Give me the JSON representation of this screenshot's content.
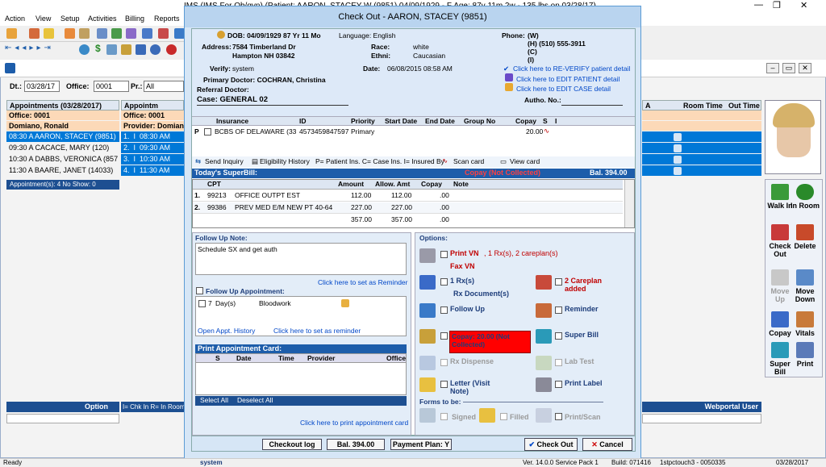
{
  "window": {
    "title": "IMS (IMS For Ob/gyn)      (Patient: AARON, STACEY W (9851) 04/09/1929 - F  Age: 87y 11m 2w - 135 lbs on 03/28/17)"
  },
  "menu": [
    "Action",
    "View",
    "Setup",
    "Activities",
    "Billing",
    "Reports"
  ],
  "filters": {
    "dt_label": "Dt.:",
    "dt_value": "03/28/17",
    "office_label": "Office:",
    "office_value": "0001",
    "pr_label": "Pr.:",
    "pr_value": "All"
  },
  "appointments": {
    "header": "Appointments (03/28/2017)",
    "office": "Office: 0001",
    "provider": "Domiano, Ronald",
    "rows": [
      "08:30 A   AARON, STACEY (9851)",
      "09:30 A   CACACE, MARY  (120)",
      "10:30 A   DABBS, VERONICA  (857",
      "11:30 A   BAARE, JANET  (14033)"
    ],
    "summary": "Appointment(s): 4   No Show: 0",
    "option": "Option",
    "legend": "I= Chk In  R= In Room"
  },
  "appt_grid2": {
    "header": "Appointm",
    "office": "Office: 0001",
    "provider": "Provider: Domian",
    "rows": [
      {
        "n": "1.",
        "t": "08:30 AM"
      },
      {
        "n": "2.",
        "t": "09:30 AM"
      },
      {
        "n": "3.",
        "t": "10:30 AM"
      },
      {
        "n": "4.",
        "t": "11:30 AM"
      }
    ]
  },
  "right_grid": {
    "cols": [
      "A",
      "Room Time",
      "Out Time"
    ]
  },
  "webportal": "Webportal User",
  "right_panel": {
    "buttons": [
      "Walk In",
      "In Room",
      "Check Out",
      "Delete",
      "Move Up",
      "Move Down",
      "Copay",
      "Vitals",
      "Super Bill",
      "Print"
    ]
  },
  "dialog": {
    "title": "Check Out - AARON, STACEY  (9851)",
    "dob": "DOB: 04/09/1929  87 Yr 11 Mo",
    "language": "Language: English",
    "phone_label": "Phone:",
    "phone_w": "(W)",
    "phone_h": "(H)  (510) 555-3911",
    "phone_c": "(C)",
    "phone_i": "(I)",
    "address_label": "Address:",
    "address1": "7584 Timberland Dr",
    "address2": "Hampton  NH  03842",
    "race_label": "Race:",
    "race": "white",
    "ethni_label": "Ethni:",
    "ethni": "Caucasian",
    "verify_label": "Verify:",
    "verify": "system",
    "date_label": "Date:",
    "date": "06/08/2015 08:58 AM",
    "reverify_link": "Click here to RE-VERIFY patient detail",
    "edit_patient_link": "Click here to EDIT PATIENT detail",
    "edit_case_link": "Click here to EDIT CASE detail",
    "primary_doctor": "Primary Doctor: COCHRAN, Christina",
    "referral_doctor": "Referral Doctor:",
    "case": "Case: GENERAL 02",
    "autho": "Autho. No.:",
    "ins_cols": [
      "Insurance",
      "ID",
      "Priority",
      "Start Date",
      "End Date",
      "Group No",
      "Copay",
      "S",
      "I"
    ],
    "ins_row": {
      "p": "P",
      "name": "BCBS OF DELAWARE  (33",
      "id": "4573459847597",
      "priority": "Primary",
      "copay": "20.00"
    },
    "ins_links": [
      "Send Inquiry",
      "Eligibility History",
      "P= Patient Ins. C= Case Ins.  I= Insured By",
      "Scan card",
      "View card"
    ],
    "superbill_title": "Today's SuperBill:",
    "superbill_copay": "Copay (Not Collected)",
    "superbill_bal": "Bal.  394.00",
    "sb_cols": [
      "CPT",
      "Amount",
      "Allow. Amt",
      "Copay",
      "Note"
    ],
    "sb_rows": [
      {
        "n": "1.",
        "cpt": "99213",
        "desc": "OFFICE OUTPT EST",
        "amt": "112.00",
        "allow": "112.00",
        "copay": ".00"
      },
      {
        "n": "2.",
        "cpt": "99386",
        "desc": "PREV MED E/M NEW PT 40-64",
        "amt": "227.00",
        "allow": "227.00",
        "copay": ".00"
      }
    ],
    "sb_total": {
      "amt": "357.00",
      "allow": "357.00",
      "copay": ".00"
    },
    "followup_note_label": "Follow Up Note:",
    "followup_note": "Schedule SX and get auth",
    "reminder_link": "Click here to set as Reminder",
    "followup_appt_label": "Follow Up Appointment:",
    "followup_appt": {
      "n": "7",
      "unit": "Day(s)",
      "what": "Bloodwork"
    },
    "open_history": "Open Appt. History",
    "set_reminder": "Click here to set as reminder",
    "print_card_label": "Print Appointment Card:",
    "card_cols": [
      "S",
      "Date",
      "Time",
      "Provider",
      "Office"
    ],
    "select_all": "Select All",
    "deselect_all": "Deselect All",
    "print_card_link": "Click here to print appointment card",
    "options_label": "Options:",
    "print_vn": "Print VN",
    "print_vn_info": ", 1 Rx(s), 2 careplan(s)",
    "fax_vn": "Fax VN",
    "rx_count": "1 Rx(s)",
    "rx_docs": "Rx Document(s)",
    "careplan": "2 Careplan added",
    "follow_up": "Follow Up",
    "reminder": "Reminder",
    "copay_box": "Copay: 20.00 (Not Collected)",
    "super_bill": "Super Bill",
    "rx_dispense": "Rx Dispense",
    "lab_test": "Lab Test",
    "letter": "Letter (Visit Note)",
    "print_label": "Print Label",
    "forms_label": "Forms to be:",
    "signed": "Signed",
    "filled": "Filled",
    "print_scan": "Print/Scan",
    "checkout_log": "Checkout log",
    "bal": "Bal.  394.00",
    "payment_plan": "Payment Plan: Y",
    "check_out": "Check Out",
    "cancel": "Cancel",
    "footer_user": "system"
  },
  "status": {
    "left": "Ready",
    "version": "Ver. 14.0.0 Service Pack 1",
    "build": "Build: 071416",
    "station": "1stpctouch3 - 0050335",
    "date": "03/28/2017"
  },
  "colors": {
    "accent": "#1d5daa",
    "selected": "#0078d7",
    "orange": "#fcd9b8",
    "alert": "#ff0000"
  }
}
